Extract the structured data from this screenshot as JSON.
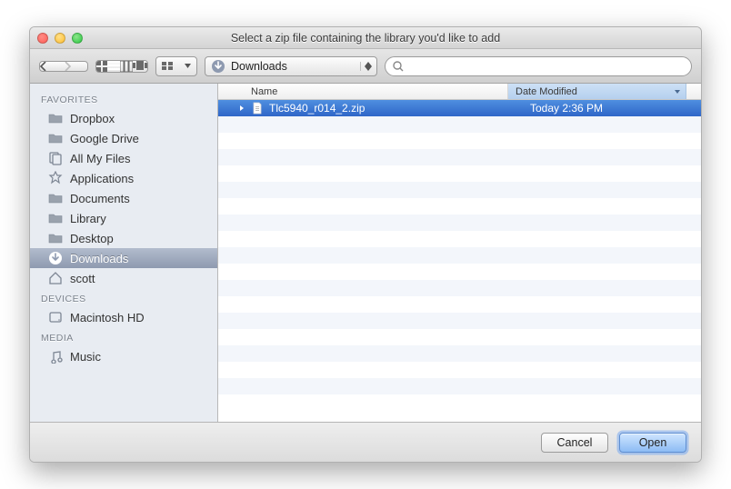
{
  "window": {
    "title": "Select a zip file containing the library you'd like to add"
  },
  "toolbar": {
    "location_label": "Downloads",
    "search_placeholder": ""
  },
  "sidebar": {
    "sections": [
      {
        "header": "FAVORITES",
        "items": [
          {
            "icon": "folder",
            "label": "Dropbox"
          },
          {
            "icon": "folder",
            "label": "Google Drive"
          },
          {
            "icon": "allfiles",
            "label": "All My Files"
          },
          {
            "icon": "apps",
            "label": "Applications"
          },
          {
            "icon": "folder",
            "label": "Documents"
          },
          {
            "icon": "folder",
            "label": "Library"
          },
          {
            "icon": "folder",
            "label": "Desktop"
          },
          {
            "icon": "downloads",
            "label": "Downloads",
            "selected": true
          },
          {
            "icon": "home",
            "label": "scott"
          }
        ]
      },
      {
        "header": "DEVICES",
        "items": [
          {
            "icon": "hdd",
            "label": "Macintosh HD"
          }
        ]
      },
      {
        "header": "MEDIA",
        "items": [
          {
            "icon": "music",
            "label": "Music"
          }
        ]
      }
    ]
  },
  "columns": {
    "name": "Name",
    "date": "Date Modified"
  },
  "files": [
    {
      "name": "Tlc5940_r014_2.zip",
      "modified": "Today 2:36 PM",
      "selected": true
    }
  ],
  "footer": {
    "cancel": "Cancel",
    "open": "Open"
  }
}
